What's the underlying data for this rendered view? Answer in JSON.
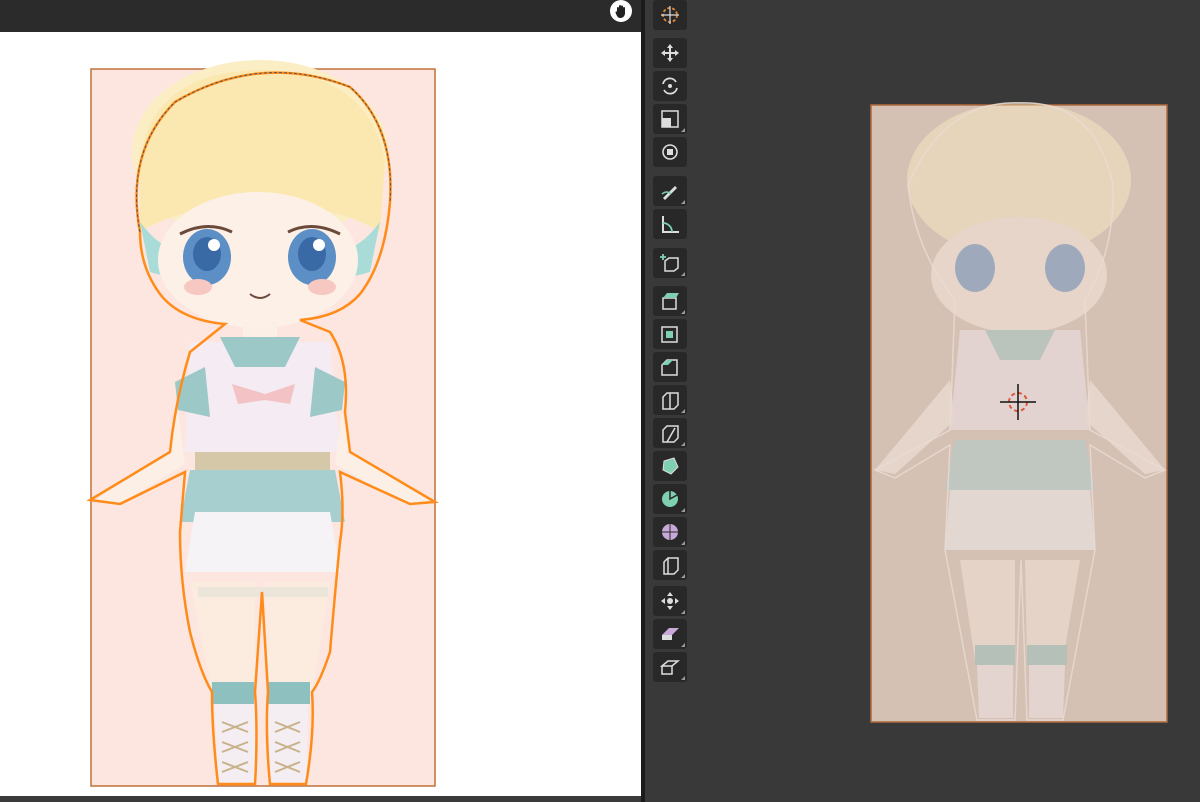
{
  "left_editor": {
    "header_icon": "hand-pan-icon",
    "background_color": "#ffffff",
    "bounding_box_color": "#c0703a",
    "fill_color": "#fde6df",
    "selection_outline_color": "#ff8c1a"
  },
  "viewport": {
    "background_color": "#393939",
    "plane_color": "#d5c0b4",
    "plane_outline_color": "#b06a3c",
    "cursor_icon": "3d-cursor-icon",
    "toolbar": {
      "tools": [
        {
          "id": "cursor",
          "icon": "cursor-icon",
          "active": true
        },
        {
          "id": "move",
          "icon": "move-icon"
        },
        {
          "id": "rotate",
          "icon": "rotate-icon"
        },
        {
          "id": "scale",
          "icon": "scale-icon"
        },
        {
          "id": "transform",
          "icon": "transform-icon"
        },
        {
          "id": "annotate",
          "icon": "annotate-icon"
        },
        {
          "id": "measure",
          "icon": "measure-icon"
        },
        {
          "id": "add-cube",
          "icon": "add-cube-icon"
        },
        {
          "id": "extrude",
          "icon": "extrude-region-icon"
        },
        {
          "id": "inset",
          "icon": "inset-faces-icon"
        },
        {
          "id": "bevel",
          "icon": "bevel-icon"
        },
        {
          "id": "loop-cut",
          "icon": "loop-cut-icon"
        },
        {
          "id": "knife",
          "icon": "knife-icon"
        },
        {
          "id": "poly-build",
          "icon": "poly-build-icon"
        },
        {
          "id": "spin",
          "icon": "spin-icon"
        },
        {
          "id": "smooth",
          "icon": "smooth-icon"
        },
        {
          "id": "edge-slide",
          "icon": "edge-slide-icon"
        },
        {
          "id": "shrink-fatten",
          "icon": "shrink-fatten-icon"
        },
        {
          "id": "shear",
          "icon": "shear-icon"
        },
        {
          "id": "rip",
          "icon": "rip-region-icon"
        }
      ]
    }
  }
}
